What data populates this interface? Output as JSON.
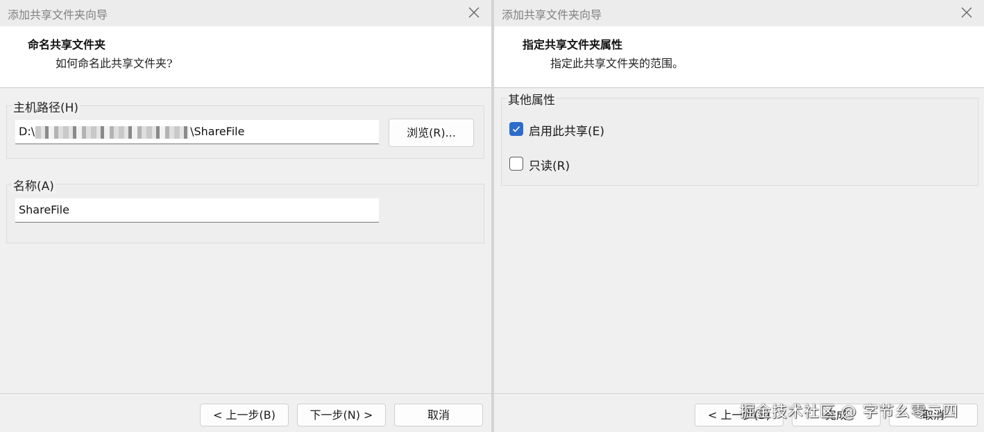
{
  "left_dialog": {
    "title": "添加共享文件夹向导",
    "header": {
      "title": "命名共享文件夹",
      "subtitle": "如何命名此共享文件夹?"
    },
    "host_path_group": {
      "label": "主机路径(H)",
      "value_prefix": "D:\\",
      "value_suffix": "\\ShareFile",
      "browse_label": "浏览(R)..."
    },
    "name_group": {
      "label": "名称(A)",
      "value": "ShareFile"
    },
    "footer": {
      "back_label": "< 上一步(B)",
      "next_label": "下一步(N) >",
      "cancel_label": "取消"
    }
  },
  "right_dialog": {
    "title": "添加共享文件夹向导",
    "header": {
      "title": "指定共享文件夹属性",
      "subtitle": "指定此共享文件夹的范围。"
    },
    "properties_group": {
      "label": "其他属性",
      "options": [
        {
          "label": "启用此共享(E)",
          "checked": true
        },
        {
          "label": "只读(R)",
          "checked": false
        }
      ]
    },
    "footer": {
      "back_label": "< 上一步(B)",
      "finish_label": "完成",
      "cancel_label": "取消"
    }
  },
  "watermark": "掘金技术社区 @ 字节幺零二四",
  "colors": {
    "accent": "#2c6ccb",
    "header_bg": "#ffffff",
    "window_bg": "#f0f0f0"
  }
}
